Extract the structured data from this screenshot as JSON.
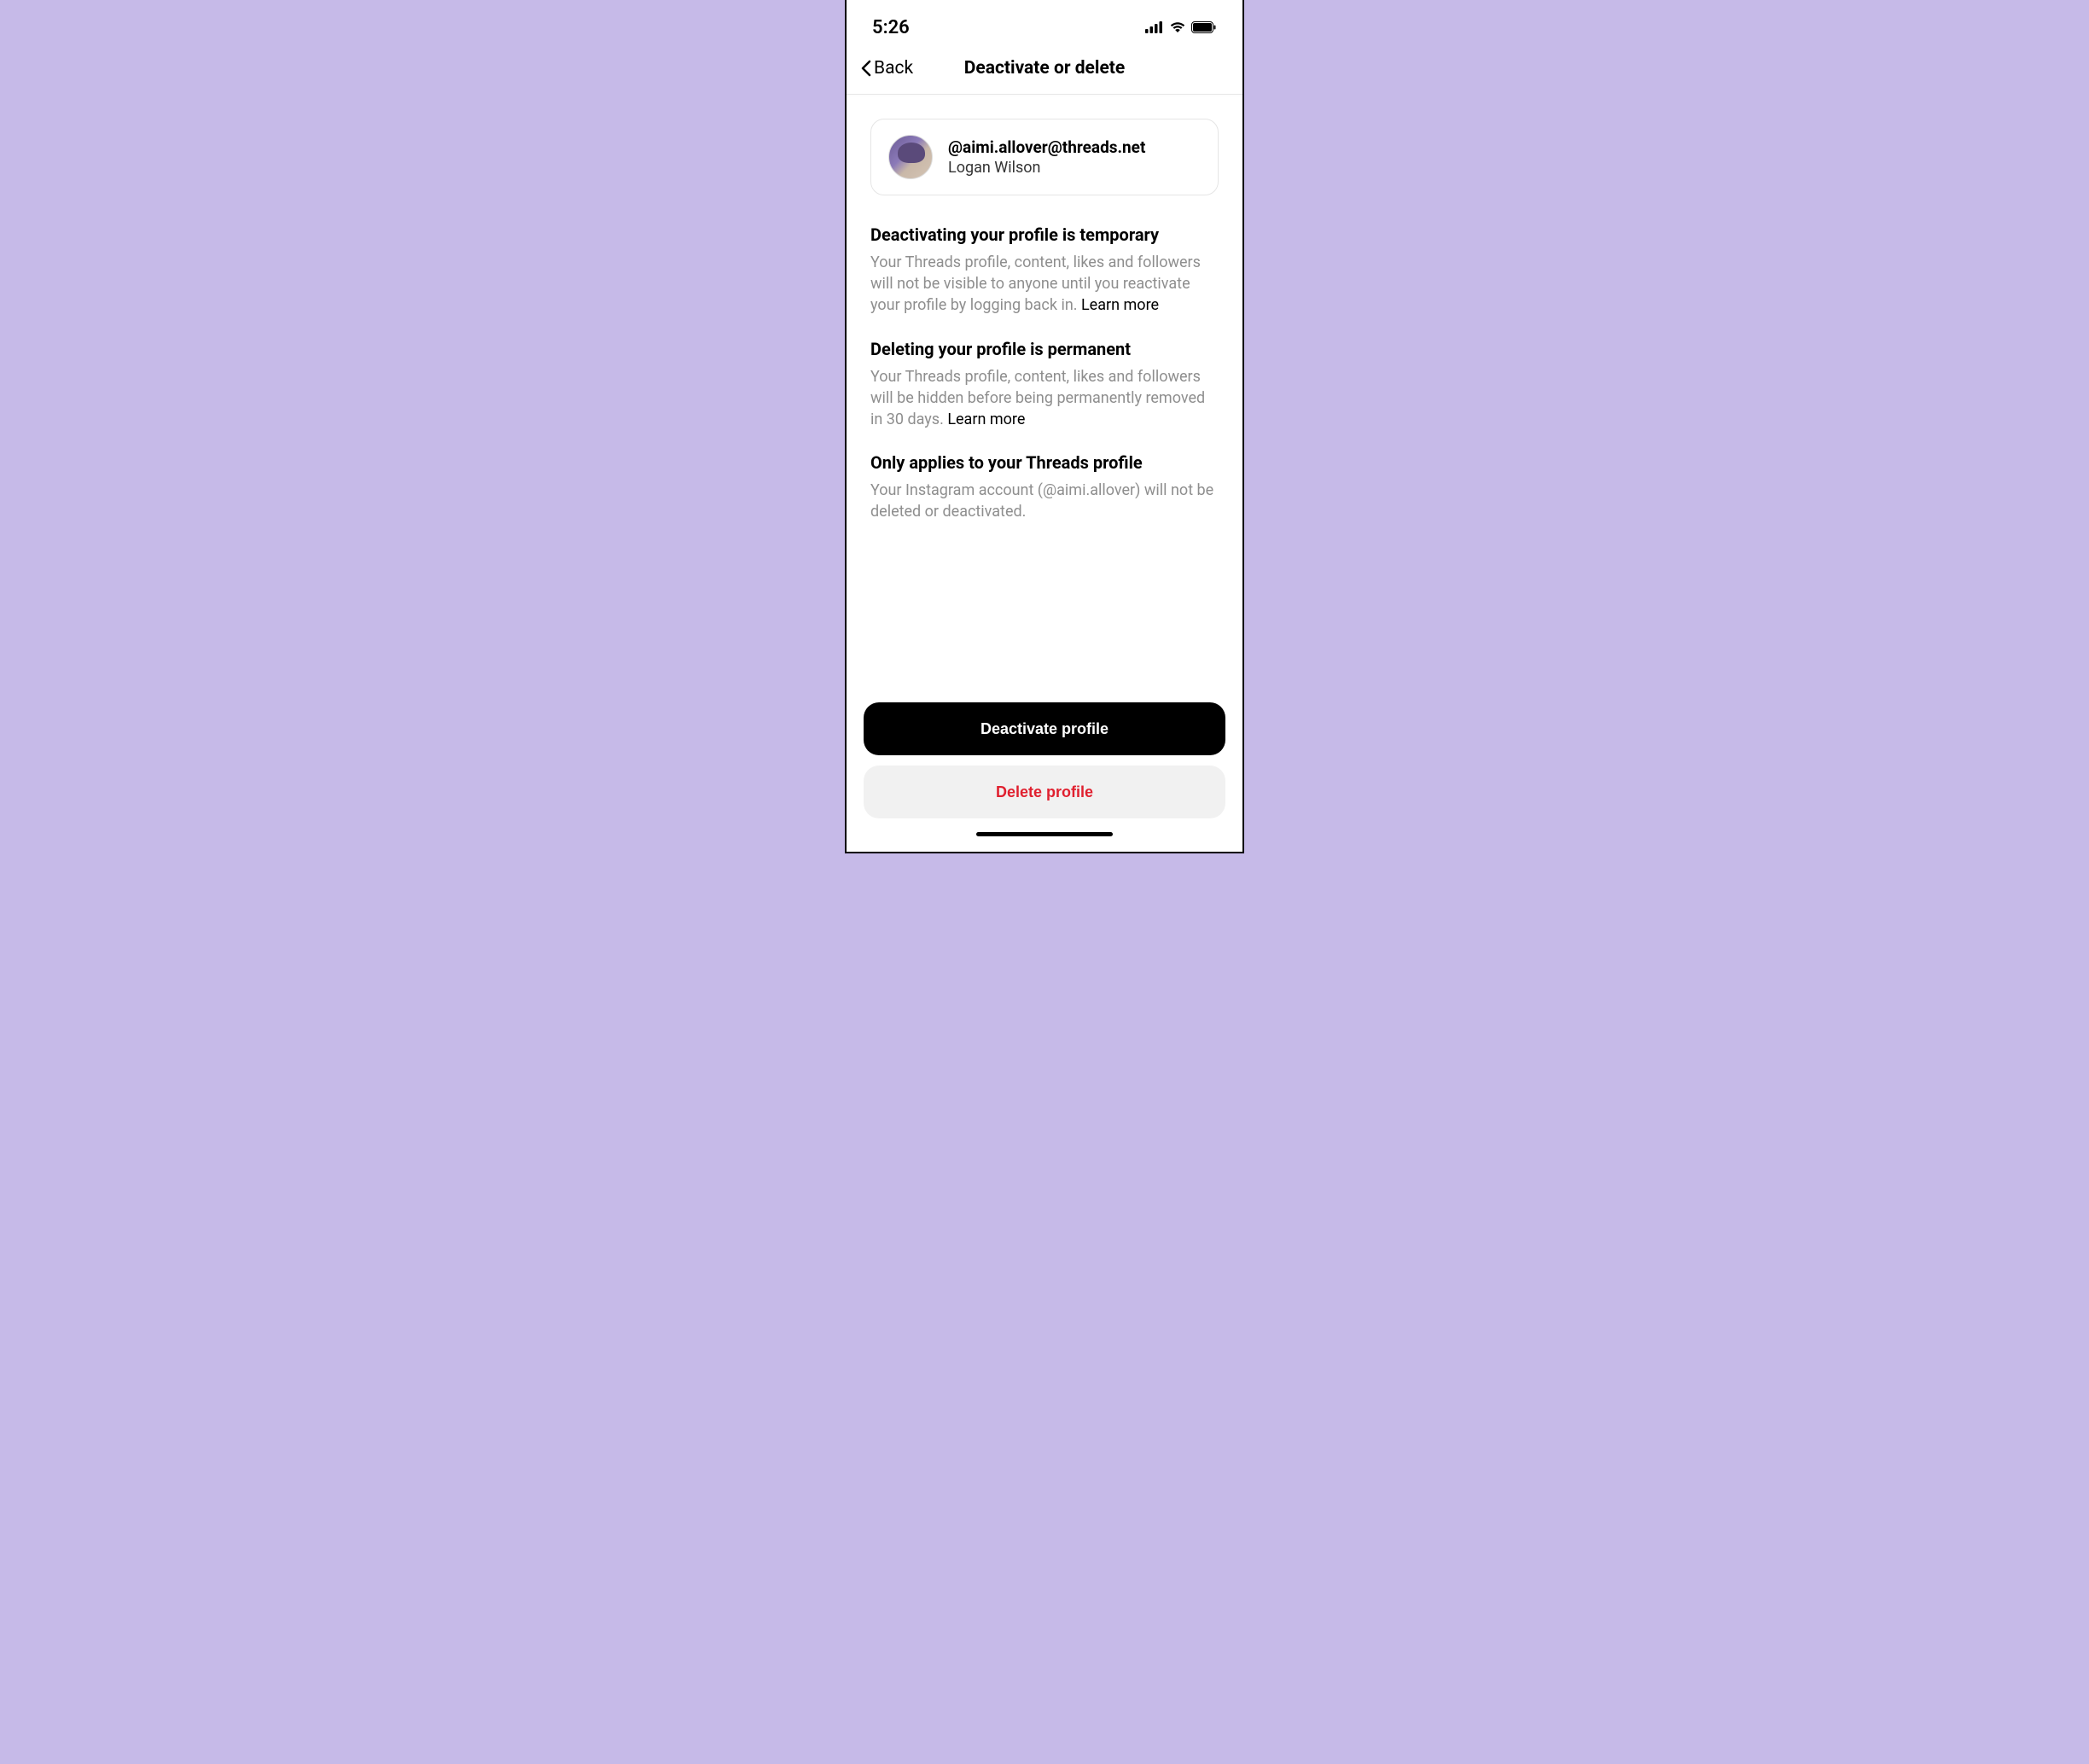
{
  "status": {
    "time": "5:26"
  },
  "nav": {
    "back_label": "Back",
    "title": "Deactivate or delete"
  },
  "account": {
    "handle": "@aimi.allover@threads.net",
    "name": "Logan Wilson"
  },
  "sections": {
    "deactivate": {
      "title": "Deactivating your profile is temporary",
      "body": "Your Threads profile, content, likes and followers will not be visible to anyone until you reactivate your profile by logging back in. ",
      "learn_more": "Learn more"
    },
    "delete": {
      "title": "Deleting your profile is permanent",
      "body": "Your Threads profile, content, likes and followers will be hidden before being permanently removed in 30 days. ",
      "learn_more": "Learn more"
    },
    "scope": {
      "title": "Only applies to your Threads profile",
      "body": "Your Instagram account (@aimi.allover) will not be deleted or deactivated."
    }
  },
  "buttons": {
    "deactivate": "Deactivate profile",
    "delete": "Delete profile"
  }
}
